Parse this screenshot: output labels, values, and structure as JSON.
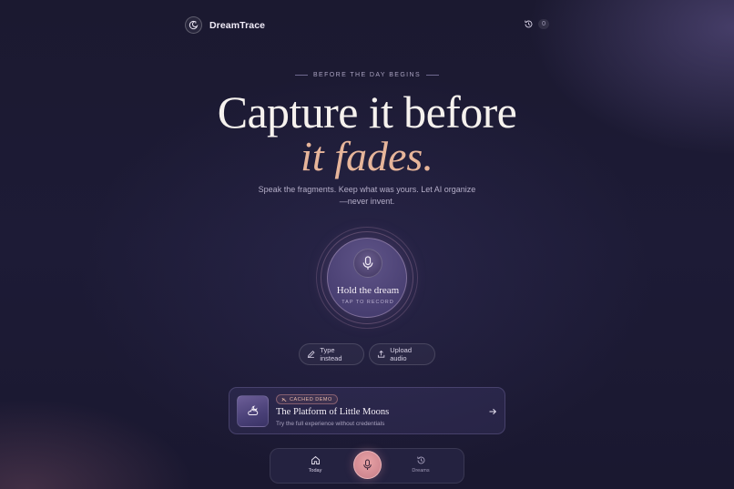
{
  "app": {
    "name": "DreamTrace",
    "logo_icon": "moon-swirl-icon"
  },
  "header": {
    "history_icon": "history-icon",
    "history_count": "0"
  },
  "hero": {
    "eyebrow": "BEFORE THE DAY BEGINS",
    "title": "Capture it before",
    "title_accent": "it fades.",
    "subtitle_line1": "Speak the fragments. Keep what was yours. Let AI organize",
    "subtitle_line2": "—never invent."
  },
  "recorder": {
    "label": "Hold the dream",
    "hint": "TAP TO RECORD",
    "icon": "microphone-icon"
  },
  "actions": {
    "type_label": "Type instead",
    "type_icon": "pencil-icon",
    "upload_label": "Upload audio",
    "upload_icon": "upload-icon"
  },
  "demo_card": {
    "badge": "CACHED DEMO",
    "title": "The Platform of Little Moons",
    "description": "Try the full experience without credentials",
    "thumb_icon": "moon-cloud-icon",
    "arrow_icon": "arrow-right-icon"
  },
  "bottom_nav": {
    "items": [
      {
        "label": "Today",
        "icon": "home-icon",
        "active": true
      },
      {
        "label": "Dreams",
        "icon": "history-icon",
        "active": false
      }
    ],
    "record_icon": "microphone-icon"
  },
  "colors": {
    "background": "#1c1a33",
    "accent": "#e7b59a",
    "record_button": "#d8909a"
  }
}
